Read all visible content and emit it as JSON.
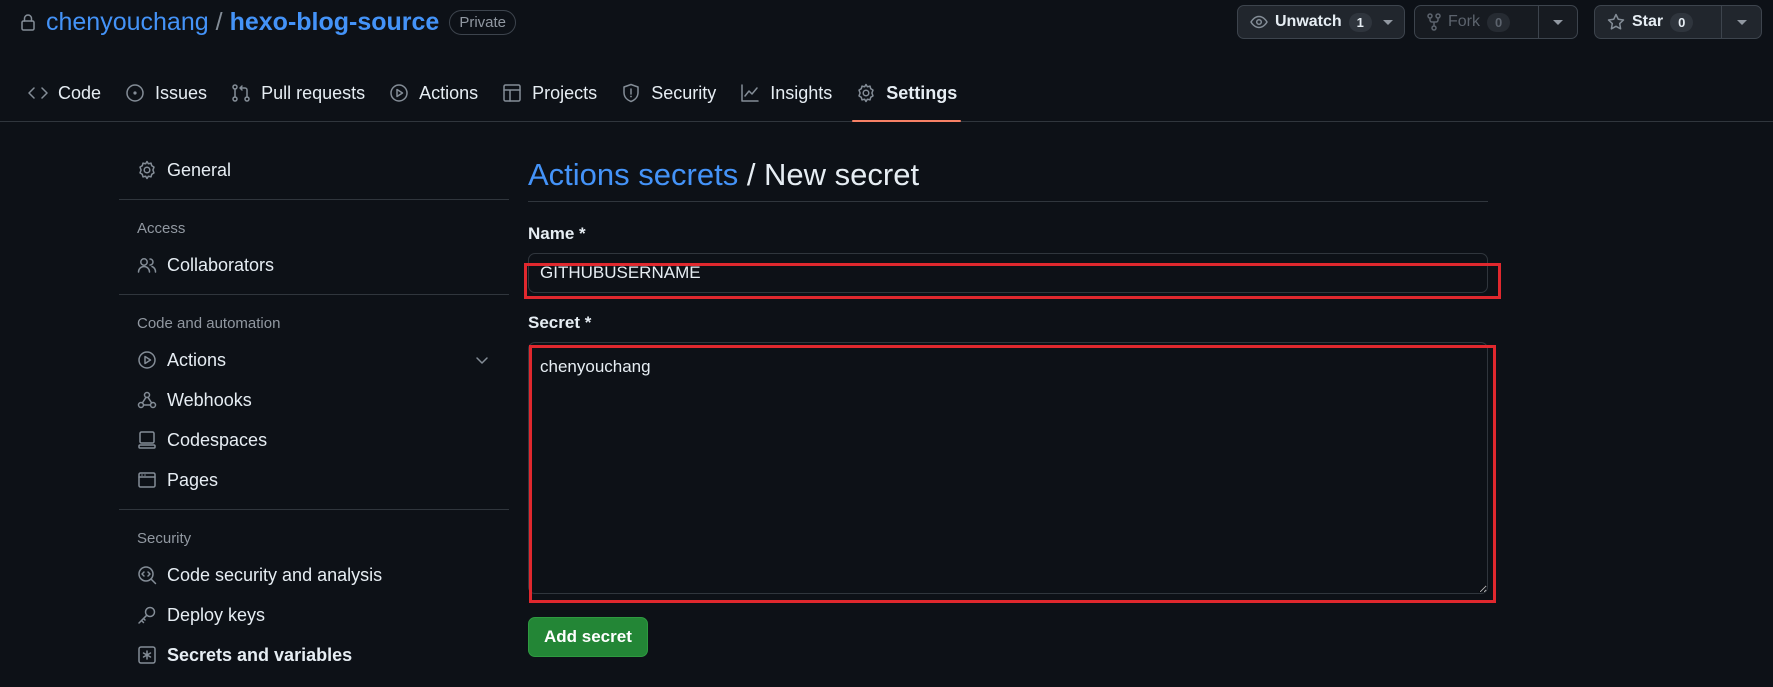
{
  "repo": {
    "owner": "chenyouchang",
    "separator": "/",
    "name": "hexo-blog-source",
    "visibility": "Private"
  },
  "actions_bar": {
    "watch_label": "Unwatch",
    "watch_count": "1",
    "fork_label": "Fork",
    "fork_count": "0",
    "star_label": "Star",
    "star_count": "0"
  },
  "nav": {
    "tabs": [
      {
        "label": "Code",
        "icon": "code-icon"
      },
      {
        "label": "Issues",
        "icon": "issue-icon"
      },
      {
        "label": "Pull requests",
        "icon": "pull-request-icon"
      },
      {
        "label": "Actions",
        "icon": "play-icon"
      },
      {
        "label": "Projects",
        "icon": "table-icon"
      },
      {
        "label": "Security",
        "icon": "shield-icon"
      },
      {
        "label": "Insights",
        "icon": "graph-icon"
      },
      {
        "label": "Settings",
        "icon": "gear-icon",
        "active": true
      }
    ]
  },
  "sidebar": {
    "general": "General",
    "access_heading": "Access",
    "collaborators": "Collaborators",
    "automation_heading": "Code and automation",
    "actions": "Actions",
    "webhooks": "Webhooks",
    "codespaces": "Codespaces",
    "pages": "Pages",
    "security_heading": "Security",
    "code_security": "Code security and analysis",
    "deploy_keys": "Deploy keys",
    "secrets": "Secrets and variables"
  },
  "main": {
    "breadcrumb_link": "Actions secrets",
    "breadcrumb_rest": " / New secret",
    "name_label": "Name *",
    "name_value": "GITHUBUSERNAME",
    "secret_label": "Secret *",
    "secret_value": "chenyouchang",
    "submit_label": "Add secret"
  },
  "colors": {
    "background": "#0d1117",
    "link": "#4493f8",
    "accent_underline": "#f78166",
    "primary_button": "#238636",
    "highlight_box": "#e0282e"
  }
}
